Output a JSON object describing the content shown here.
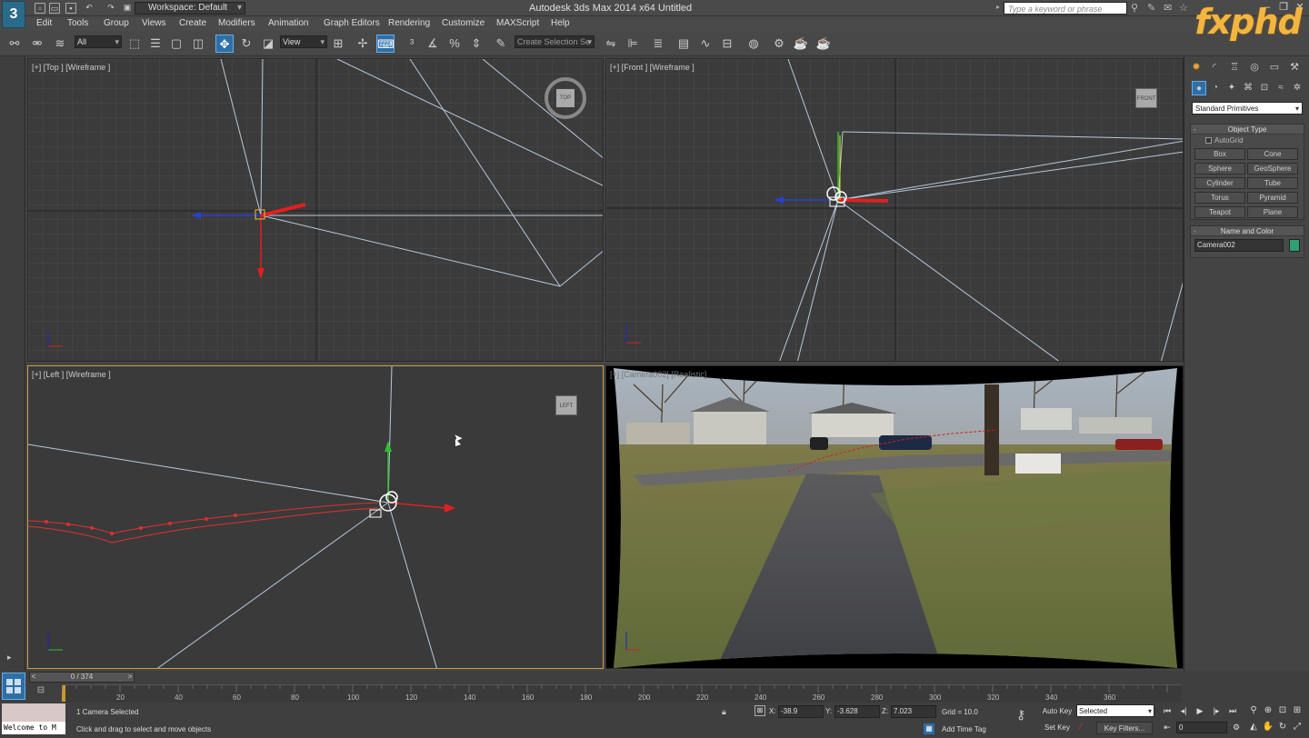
{
  "titlebar": {
    "title": "Autodesk 3ds Max  2014 x64    Untitled",
    "workspace": "Workspace: Default",
    "search_placeholder": "Type a keyword or phrase",
    "brand_logo": "fxphd"
  },
  "menu": [
    "Edit",
    "Tools",
    "Group",
    "Views",
    "Create",
    "Modifiers",
    "Animation",
    "Graph Editors",
    "Rendering",
    "Customize",
    "MAXScript",
    "Help"
  ],
  "toolbar": {
    "selection_filter": "All",
    "reference_coord": "View",
    "named_selection_placeholder": "Create Selection Se"
  },
  "viewports": {
    "top": {
      "label": "[+] [Top ] [Wireframe ]"
    },
    "front": {
      "label": "[+] [Front ] [Wireframe ]"
    },
    "left": {
      "label": "[+] [Left ] [Wireframe ]"
    },
    "camera": {
      "label": "[+] [Camera002] [Realistic]"
    }
  },
  "command_panel": {
    "category": "Standard Primitives",
    "object_type_title": "Object Type",
    "autogrid_label": "AutoGrid",
    "primitives": [
      "Box",
      "Cone",
      "Sphere",
      "GeoSphere",
      "Cylinder",
      "Tube",
      "Torus",
      "Pyramid",
      "Teapot",
      "Plane"
    ],
    "name_color_title": "Name and Color",
    "object_name": "Camera002",
    "object_color": "#2fa070"
  },
  "timeline": {
    "frame_display": "0 / 374",
    "ticks": [
      "20",
      "40",
      "60",
      "80",
      "100",
      "120",
      "140",
      "160",
      "180",
      "200",
      "220",
      "240",
      "260",
      "280",
      "300",
      "320",
      "340",
      "360"
    ]
  },
  "status": {
    "maxscript_output": "Welcome to M",
    "selection": "1 Camera Selected",
    "prompt": "Click and drag to select and move objects",
    "x_label": "X:",
    "x": "-38.9",
    "y_label": "Y:",
    "y": "-3.628",
    "z_label": "Z:",
    "z": "7.023",
    "grid": "Grid = 10.0",
    "add_time_tag": "Add Time Tag",
    "auto_key": "Auto Key",
    "set_key": "Set Key",
    "key_mode": "Selected",
    "key_filters": "Key Filters...",
    "current_frame": "0"
  },
  "colors": {
    "accent": "#2d6fa6",
    "active_viewport": "#c8a040",
    "path": "#e03030",
    "brand": "#f2b640"
  }
}
